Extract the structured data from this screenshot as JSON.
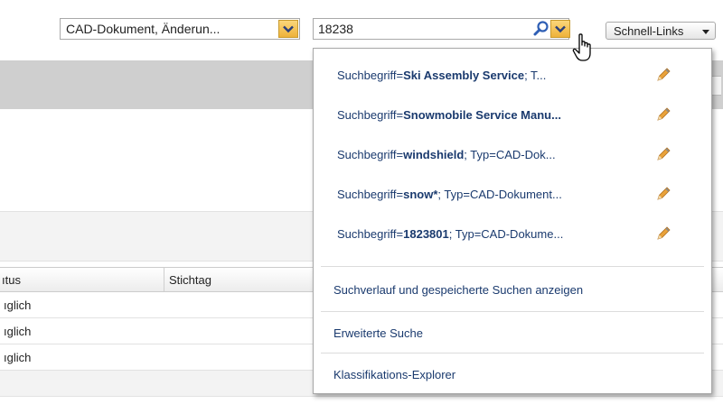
{
  "toolbar": {
    "type_select_value": "CAD-Dokument, Änderun...",
    "search_value": "18238",
    "quick_links_label": "Schnell-Links"
  },
  "table": {
    "columns": [
      "ıtus",
      "Stichtag"
    ],
    "rows": [
      {
        "status": "ıglich"
      },
      {
        "status": "ıglich"
      },
      {
        "status": "ıglich"
      }
    ]
  },
  "search_menu": {
    "recent_searches": [
      {
        "label": "Suchbegriff=",
        "term": "Ski Assembly Service",
        "rest": "; T..."
      },
      {
        "label": "Suchbegriff=",
        "term": "Snowmobile Service Manu...",
        "rest": ""
      },
      {
        "label": "Suchbegriff=",
        "term": "windshield",
        "rest": "; Typ=CAD-Dok..."
      },
      {
        "label": "Suchbegriff=",
        "term": "snow*",
        "rest": "; Typ=CAD-Dokument..."
      },
      {
        "label": "Suchbegriff=",
        "term": "1823801",
        "rest": "; Typ=CAD-Dokume..."
      }
    ],
    "links": [
      "Suchverlauf und gespeicherte Suchen anzeigen",
      "Erweiterte Suche",
      "Klassifikations-Explorer"
    ]
  },
  "icons": {
    "search": "magnifier-icon",
    "dropdown": "chevron-down-icon",
    "edit": "pencil-icon",
    "cursor": "hand-pointer-icon"
  },
  "colors": {
    "accent_button": "#f0b53e",
    "menu_text": "#1a3a6e",
    "band": "#cfcfcf"
  }
}
